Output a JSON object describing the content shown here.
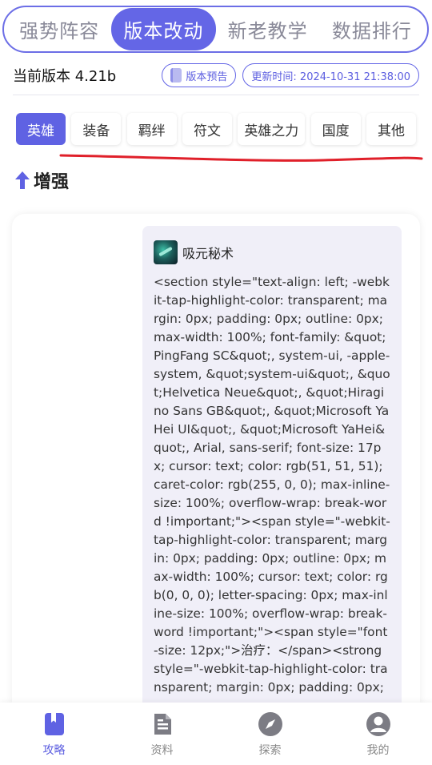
{
  "top_tabs": [
    {
      "label": "强势阵容",
      "active": false
    },
    {
      "label": "版本改动",
      "active": true
    },
    {
      "label": "新老教学",
      "active": false
    },
    {
      "label": "数据排行",
      "active": false
    }
  ],
  "version": {
    "current_label": "当前版本 4.21b",
    "preview_label": "版本预告",
    "update_time_label": "更新时间: 2024-10-31 21:38:00"
  },
  "chips": [
    {
      "label": "英雄",
      "active": true
    },
    {
      "label": "装备",
      "active": false
    },
    {
      "label": "羁绊",
      "active": false
    },
    {
      "label": "符文",
      "active": false
    },
    {
      "label": "英雄之力",
      "active": false
    },
    {
      "label": "国度",
      "active": false
    },
    {
      "label": "其他",
      "active": false
    }
  ],
  "section": {
    "title": "增强"
  },
  "card": {
    "skill_name": "吸元秘术",
    "raw_text": "<section style=\"text-align: left; -webkit-tap-highlight-color: transparent; margin: 0px; padding: 0px; outline: 0px; max-width: 100%; font-family: &quot;PingFang SC&quot;, system-ui, -apple-system, &quot;system-ui&quot;, &quot;Helvetica Neue&quot;, &quot;Hiragino Sans GB&quot;, &quot;Microsoft YaHei UI&quot;, &quot;Microsoft YaHei&quot;, Arial, sans-serif; font-size: 17px; cursor: text; color: rgb(51, 51, 51); caret-color: rgb(255, 0, 0); max-inline-size: 100%; overflow-wrap: break-word !important;\"><span style=\"-webkit-tap-highlight-color: transparent; margin: 0px; padding: 0px; outline: 0px; max-width: 100%; cursor: text; color: rgb(0, 0, 0); letter-spacing: 0px; max-inline-size: 100%; overflow-wrap: break-word !important;\"><span style=\"font-size: 12px;\">治疗：</span><strong style=\"-webkit-tap-highlight-color: transparent; margin: 0px; padding: 0px;"
  },
  "bottom_nav": [
    {
      "label": "攻略",
      "icon": "book-icon",
      "active": true
    },
    {
      "label": "资料",
      "icon": "document-icon",
      "active": false
    },
    {
      "label": "探索",
      "icon": "compass-icon",
      "active": false
    },
    {
      "label": "我的",
      "icon": "user-icon",
      "active": false
    }
  ],
  "colors": {
    "accent": "#6466e6",
    "underline": "#e0202a",
    "inner_bg": "#f0eff8"
  }
}
